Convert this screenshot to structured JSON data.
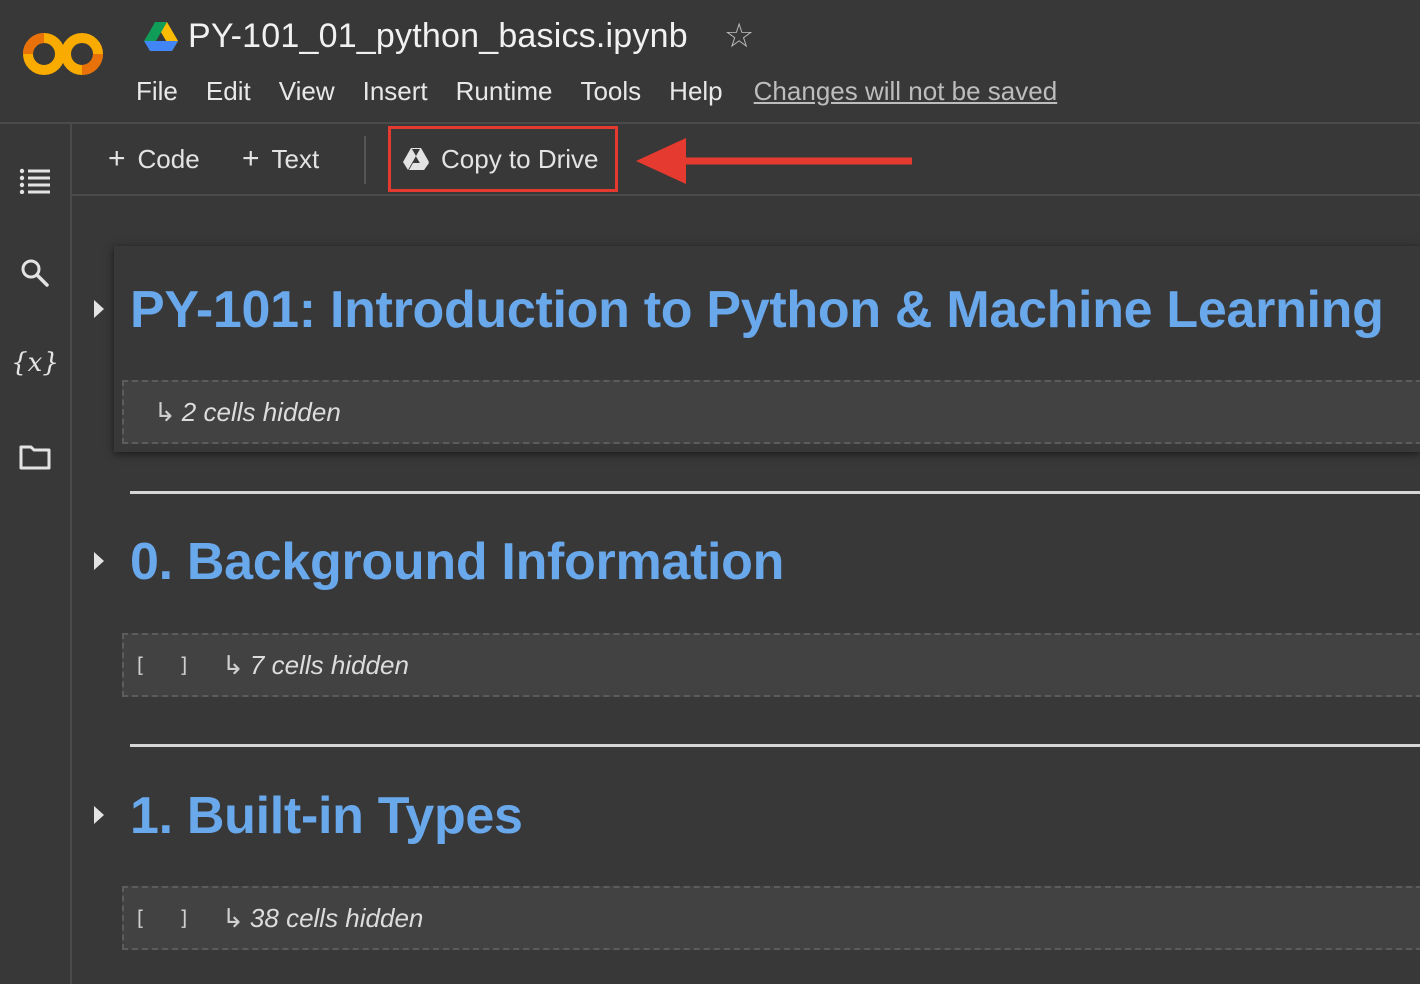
{
  "header": {
    "logo_text": "CO",
    "doc_title": "PY-101_01_python_basics.ipynb",
    "star_icon": "star-outline-icon",
    "menu": [
      "File",
      "Edit",
      "View",
      "Insert",
      "Runtime",
      "Tools",
      "Help"
    ],
    "unsaved_notice": "Changes will not be saved"
  },
  "rail": {
    "icons": [
      "table-of-contents-icon",
      "search-icon",
      "variables-icon",
      "folder-icon"
    ],
    "variables_label": "{x}"
  },
  "toolbar": {
    "code_label": "Code",
    "text_label": "Text",
    "copy_label": "Copy to Drive",
    "highlight_color": "#e53a2f"
  },
  "notebook": {
    "sections": [
      {
        "heading": "PY-101: Introduction to Python & Machine Learning",
        "hidden": "2 cells hidden",
        "brackets": ""
      },
      {
        "heading": "0. Background Information",
        "hidden": "7 cells hidden",
        "brackets": "[ ]"
      },
      {
        "heading": "1. Built-in Types",
        "hidden": "38 cells hidden",
        "brackets": "[ ]"
      }
    ],
    "heading_color": "#6aa8ec"
  }
}
